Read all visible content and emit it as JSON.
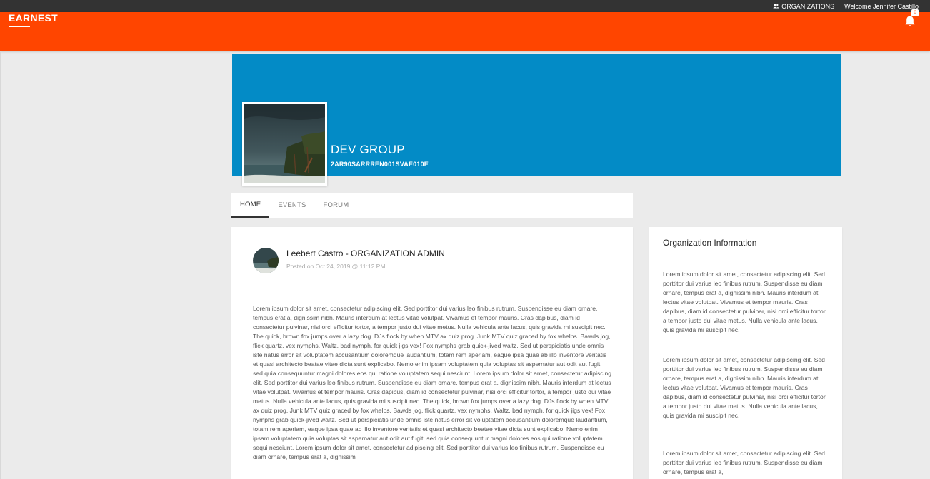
{
  "topbar": {
    "organizations_label": "ORGANIZATIONS",
    "welcome_text": "Welcome Jennifer Castillo"
  },
  "navbar": {
    "brand": "EARNEST",
    "notification_count": "0",
    "color": "#ff4500"
  },
  "group": {
    "name": "DEV GROUP",
    "code": "2AR90SARRREN001SVAE010E",
    "banner_color": "#038bc6"
  },
  "tabs": [
    {
      "label": "HOME",
      "active": true
    },
    {
      "label": "EVENTS",
      "active": false
    },
    {
      "label": "FORUM",
      "active": false
    }
  ],
  "post": {
    "author": "Leebert Castro - ORGANIZATION ADMIN",
    "date": "Posted on Oct 24, 2019 @ 11:12 PM",
    "body": "Lorem ipsum dolor sit amet, consectetur adipiscing elit. Sed porttitor dui varius leo finibus rutrum. Suspendisse eu diam ornare, tempus erat a, dignissim nibh. Mauris interdum at lectus vitae volutpat. Vivamus et tempor mauris. Cras dapibus, diam id consectetur pulvinar, nisi orci efficitur tortor, a tempor justo dui vitae metus. Nulla vehicula ante lacus, quis gravida mi suscipit nec. The quick, brown fox jumps over a lazy dog. DJs flock by when MTV ax quiz prog. Junk MTV quiz graced by fox whelps. Bawds jog, flick quartz, vex nymphs. Waltz, bad nymph, for quick jigs vex! Fox nymphs grab quick-jived waltz. Sed ut perspiciatis unde omnis iste natus error sit voluptatem accusantium doloremque laudantium, totam rem aperiam, eaque ipsa quae ab illo inventore veritatis et quasi architecto beatae vitae dicta sunt explicabo. Nemo enim ipsam voluptatem quia voluptas sit aspernatur aut odit aut fugit, sed quia consequuntur magni dolores eos qui ratione voluptatem sequi nesciunt. Lorem ipsum dolor sit amet, consectetur adipiscing elit. Sed porttitor dui varius leo finibus rutrum. Suspendisse eu diam ornare, tempus erat a, dignissim nibh. Mauris interdum at lectus vitae volutpat. Vivamus et tempor mauris. Cras dapibus, diam id consectetur pulvinar, nisi orci efficitur tortor, a tempor justo dui vitae metus. Nulla vehicula ante lacus, quis gravida mi suscipit nec. The quick, brown fox jumps over a lazy dog. DJs flock by when MTV ax quiz prog. Junk MTV quiz graced by fox whelps. Bawds jog, flick quartz, vex nymphs. Waltz, bad nymph, for quick jigs vex! Fox nymphs grab quick-jived waltz. Sed ut perspiciatis unde omnis iste natus error sit voluptatem accusantium doloremque laudantium, totam rem aperiam, eaque ipsa quae ab illo inventore veritatis et quasi architecto beatae vitae dicta sunt explicabo. Nemo enim ipsam voluptatem quia voluptas sit aspernatur aut odit aut fugit, sed quia consequuntur magni dolores eos qui ratione voluptatem sequi nesciunt. Lorem ipsum dolor sit amet, consectetur adipiscing elit. Sed porttitor dui varius leo finibus rutrum. Suspendisse eu diam ornare, tempus erat a, dignissim"
  },
  "info": {
    "title": "Organization Information",
    "paragraphs": [
      "Lorem ipsum dolor sit amet, consectetur adipiscing elit. Sed porttitor dui varius leo finibus rutrum. Suspendisse eu diam ornare, tempus erat a, dignissim nibh. Mauris interdum at lectus vitae volutpat. Vivamus et tempor mauris. Cras dapibus, diam id consectetur pulvinar, nisi orci efficitur tortor, a tempor justo dui vitae metus. Nulla vehicula ante lacus, quis gravida mi suscipit nec.",
      "Lorem ipsum dolor sit amet, consectetur adipiscing elit. Sed porttitor dui varius leo finibus rutrum. Suspendisse eu diam ornare, tempus erat a, dignissim nibh. Mauris interdum at lectus vitae volutpat. Vivamus et tempor mauris. Cras dapibus, diam id consectetur pulvinar, nisi orci efficitur tortor, a tempor justo dui vitae metus. Nulla vehicula ante lacus, quis gravida mi suscipit nec.",
      "Lorem ipsum dolor sit amet, consectetur adipiscing elit. Sed porttitor dui varius leo finibus rutrum. Suspendisse eu diam ornare, tempus erat a,"
    ]
  }
}
